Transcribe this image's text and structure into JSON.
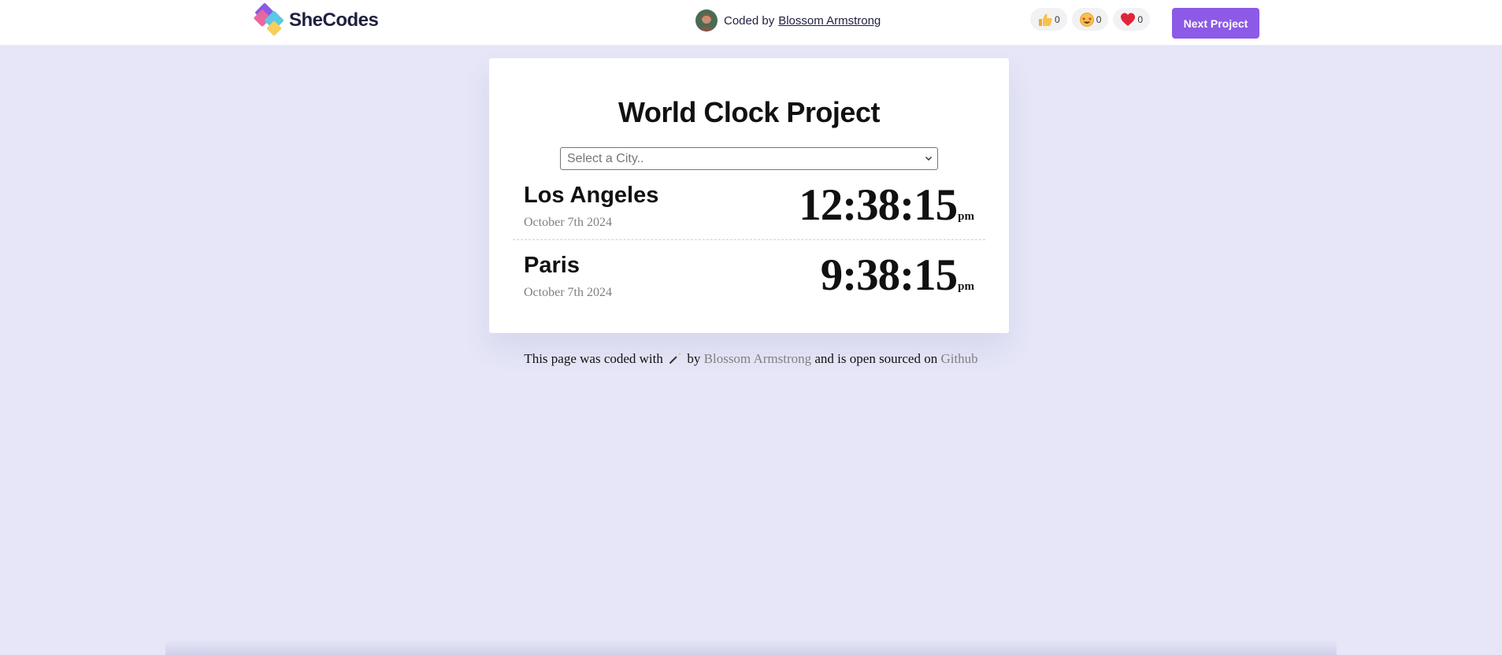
{
  "brand": {
    "name": "SheCodes",
    "colors": {
      "pink": "#e8679c",
      "purple": "#8c5ae6",
      "blue": "#5ac8e6",
      "yellow": "#f5cf5a"
    }
  },
  "header": {
    "coded_by_prefix": "Coded by",
    "author": "Blossom Armstrong",
    "reactions": [
      {
        "icon": "thumbs-up-icon",
        "count": "0"
      },
      {
        "icon": "star-struck-icon",
        "count": "0"
      },
      {
        "icon": "heart-icon",
        "count": "0"
      }
    ],
    "next_button": "Next Project",
    "accent": "#8c5ae6"
  },
  "card": {
    "title": "World Clock Project",
    "select": {
      "placeholder": "Select a City.."
    },
    "cities": [
      {
        "name": "Los Angeles",
        "date": "October 7th 2024",
        "time": "12:38:15",
        "ampm": "pm"
      },
      {
        "name": "Paris",
        "date": "October 7th 2024",
        "time": "9:38:15",
        "ampm": "pm"
      }
    ]
  },
  "footer": {
    "text_before": "This page was coded with",
    "text_by": "by",
    "author_link": "Blossom Armstrong",
    "text_middle": "and is open sourced on",
    "github_link": "Github"
  },
  "colors": {
    "background": "#e6e6f8",
    "muted_text": "#808080"
  }
}
